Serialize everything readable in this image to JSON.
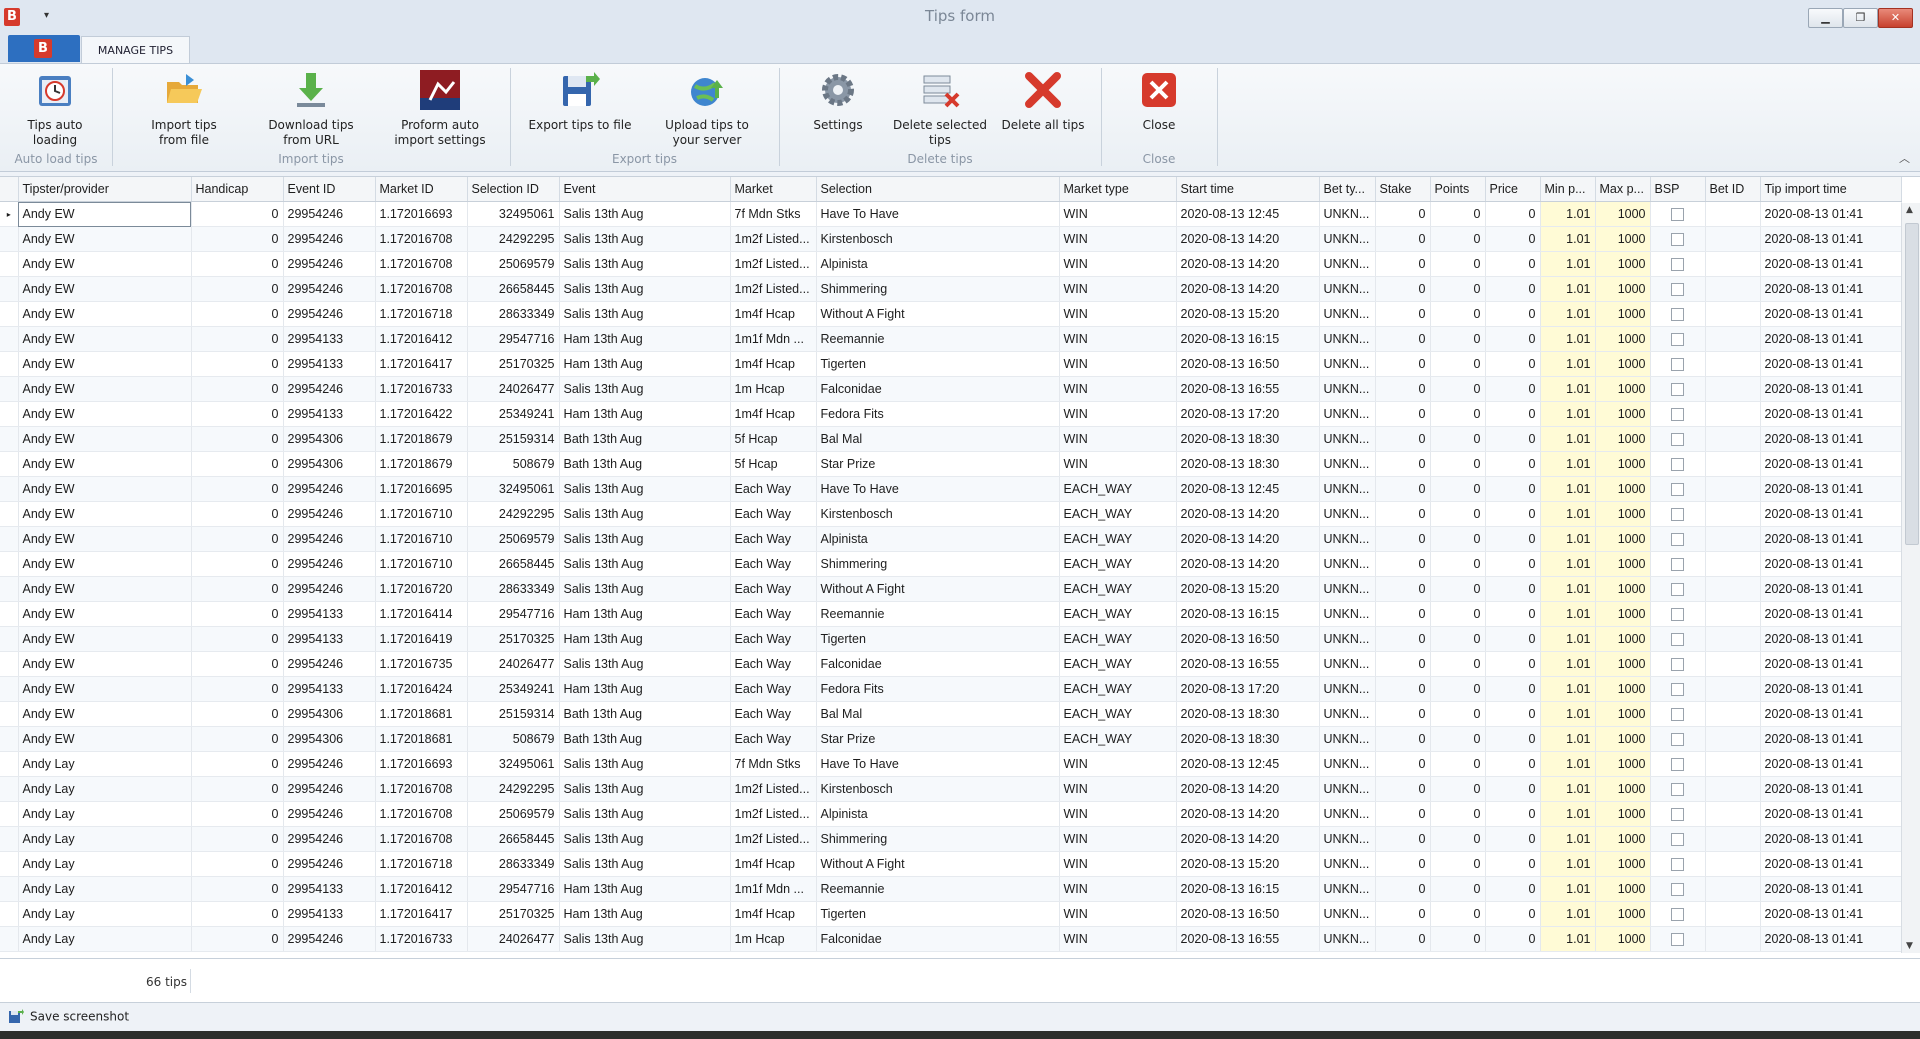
{
  "window": {
    "title": "Tips form",
    "app_logo": "B"
  },
  "tabs": {
    "active": "MANAGE TIPS"
  },
  "ribbon": {
    "buttons": [
      {
        "label": "Tips auto loading",
        "icon": "auto-load-icon"
      },
      {
        "label": "Import tips from file",
        "icon": "folder-open-icon"
      },
      {
        "label": "Download tips from URL",
        "icon": "download-icon"
      },
      {
        "label": "Proform auto import settings",
        "icon": "proform-icon"
      },
      {
        "label": "Export tips to file",
        "icon": "save-export-icon"
      },
      {
        "label": "Upload tips to your server",
        "icon": "globe-upload-icon"
      },
      {
        "label": "Settings",
        "icon": "gear-icon"
      },
      {
        "label": "Delete selected tips",
        "icon": "delete-selected-icon"
      },
      {
        "label": "Delete all tips",
        "icon": "delete-all-icon"
      },
      {
        "label": "Close",
        "icon": "close-icon"
      }
    ],
    "groups": [
      "Auto load tips",
      "Import tips",
      "Export tips",
      "Delete tips",
      "Close"
    ]
  },
  "grid": {
    "columns": [
      "Tipster/provider",
      "Handicap",
      "Event ID",
      "Market ID",
      "Selection ID",
      "Event",
      "Market",
      "Selection",
      "Market type",
      "Start time",
      "Bet ty...",
      "Stake",
      "Points",
      "Price",
      "Min p...",
      "Max p...",
      "BSP",
      "Bet ID",
      "Tip import time"
    ],
    "rows": [
      [
        "Andy EW",
        "0",
        "29954246",
        "1.172016693",
        "32495061",
        "Salis  13th Aug",
        "7f Mdn Stks",
        "Have To Have",
        "WIN",
        "2020-08-13 12:45",
        "UNKN...",
        "0",
        "0",
        "0",
        "1.01",
        "1000",
        "",
        "",
        "2020-08-13 01:41"
      ],
      [
        "Andy EW",
        "0",
        "29954246",
        "1.172016708",
        "24292295",
        "Salis  13th Aug",
        "1m2f Listed...",
        "Kirstenbosch",
        "WIN",
        "2020-08-13 14:20",
        "UNKN...",
        "0",
        "0",
        "0",
        "1.01",
        "1000",
        "",
        "",
        "2020-08-13 01:41"
      ],
      [
        "Andy EW",
        "0",
        "29954246",
        "1.172016708",
        "25069579",
        "Salis  13th Aug",
        "1m2f Listed...",
        "Alpinista",
        "WIN",
        "2020-08-13 14:20",
        "UNKN...",
        "0",
        "0",
        "0",
        "1.01",
        "1000",
        "",
        "",
        "2020-08-13 01:41"
      ],
      [
        "Andy EW",
        "0",
        "29954246",
        "1.172016708",
        "26658445",
        "Salis  13th Aug",
        "1m2f Listed...",
        "Shimmering",
        "WIN",
        "2020-08-13 14:20",
        "UNKN...",
        "0",
        "0",
        "0",
        "1.01",
        "1000",
        "",
        "",
        "2020-08-13 01:41"
      ],
      [
        "Andy EW",
        "0",
        "29954246",
        "1.172016718",
        "28633349",
        "Salis  13th Aug",
        "1m4f Hcap",
        "Without A Fight",
        "WIN",
        "2020-08-13 15:20",
        "UNKN...",
        "0",
        "0",
        "0",
        "1.01",
        "1000",
        "",
        "",
        "2020-08-13 01:41"
      ],
      [
        "Andy EW",
        "0",
        "29954133",
        "1.172016412",
        "29547716",
        "Ham  13th Aug",
        "1m1f Mdn ...",
        "Reemannie",
        "WIN",
        "2020-08-13 16:15",
        "UNKN...",
        "0",
        "0",
        "0",
        "1.01",
        "1000",
        "",
        "",
        "2020-08-13 01:41"
      ],
      [
        "Andy EW",
        "0",
        "29954133",
        "1.172016417",
        "25170325",
        "Ham  13th Aug",
        "1m4f Hcap",
        "Tigerten",
        "WIN",
        "2020-08-13 16:50",
        "UNKN...",
        "0",
        "0",
        "0",
        "1.01",
        "1000",
        "",
        "",
        "2020-08-13 01:41"
      ],
      [
        "Andy EW",
        "0",
        "29954246",
        "1.172016733",
        "24026477",
        "Salis  13th Aug",
        "1m Hcap",
        "Falconidae",
        "WIN",
        "2020-08-13 16:55",
        "UNKN...",
        "0",
        "0",
        "0",
        "1.01",
        "1000",
        "",
        "",
        "2020-08-13 01:41"
      ],
      [
        "Andy EW",
        "0",
        "29954133",
        "1.172016422",
        "25349241",
        "Ham  13th Aug",
        "1m4f Hcap",
        "Fedora Fits",
        "WIN",
        "2020-08-13 17:20",
        "UNKN...",
        "0",
        "0",
        "0",
        "1.01",
        "1000",
        "",
        "",
        "2020-08-13 01:41"
      ],
      [
        "Andy EW",
        "0",
        "29954306",
        "1.172018679",
        "25159314",
        "Bath  13th Aug",
        "5f Hcap",
        "Bal Mal",
        "WIN",
        "2020-08-13 18:30",
        "UNKN...",
        "0",
        "0",
        "0",
        "1.01",
        "1000",
        "",
        "",
        "2020-08-13 01:41"
      ],
      [
        "Andy EW",
        "0",
        "29954306",
        "1.172018679",
        "508679",
        "Bath  13th Aug",
        "5f Hcap",
        "Star Prize",
        "WIN",
        "2020-08-13 18:30",
        "UNKN...",
        "0",
        "0",
        "0",
        "1.01",
        "1000",
        "",
        "",
        "2020-08-13 01:41"
      ],
      [
        "Andy EW",
        "0",
        "29954246",
        "1.172016695",
        "32495061",
        "Salis  13th Aug",
        "Each Way",
        "Have To Have",
        "EACH_WAY",
        "2020-08-13 12:45",
        "UNKN...",
        "0",
        "0",
        "0",
        "1.01",
        "1000",
        "",
        "",
        "2020-08-13 01:41"
      ],
      [
        "Andy EW",
        "0",
        "29954246",
        "1.172016710",
        "24292295",
        "Salis  13th Aug",
        "Each Way",
        "Kirstenbosch",
        "EACH_WAY",
        "2020-08-13 14:20",
        "UNKN...",
        "0",
        "0",
        "0",
        "1.01",
        "1000",
        "",
        "",
        "2020-08-13 01:41"
      ],
      [
        "Andy EW",
        "0",
        "29954246",
        "1.172016710",
        "25069579",
        "Salis  13th Aug",
        "Each Way",
        "Alpinista",
        "EACH_WAY",
        "2020-08-13 14:20",
        "UNKN...",
        "0",
        "0",
        "0",
        "1.01",
        "1000",
        "",
        "",
        "2020-08-13 01:41"
      ],
      [
        "Andy EW",
        "0",
        "29954246",
        "1.172016710",
        "26658445",
        "Salis  13th Aug",
        "Each Way",
        "Shimmering",
        "EACH_WAY",
        "2020-08-13 14:20",
        "UNKN...",
        "0",
        "0",
        "0",
        "1.01",
        "1000",
        "",
        "",
        "2020-08-13 01:41"
      ],
      [
        "Andy EW",
        "0",
        "29954246",
        "1.172016720",
        "28633349",
        "Salis  13th Aug",
        "Each Way",
        "Without A Fight",
        "EACH_WAY",
        "2020-08-13 15:20",
        "UNKN...",
        "0",
        "0",
        "0",
        "1.01",
        "1000",
        "",
        "",
        "2020-08-13 01:41"
      ],
      [
        "Andy EW",
        "0",
        "29954133",
        "1.172016414",
        "29547716",
        "Ham  13th Aug",
        "Each Way",
        "Reemannie",
        "EACH_WAY",
        "2020-08-13 16:15",
        "UNKN...",
        "0",
        "0",
        "0",
        "1.01",
        "1000",
        "",
        "",
        "2020-08-13 01:41"
      ],
      [
        "Andy EW",
        "0",
        "29954133",
        "1.172016419",
        "25170325",
        "Ham  13th Aug",
        "Each Way",
        "Tigerten",
        "EACH_WAY",
        "2020-08-13 16:50",
        "UNKN...",
        "0",
        "0",
        "0",
        "1.01",
        "1000",
        "",
        "",
        "2020-08-13 01:41"
      ],
      [
        "Andy EW",
        "0",
        "29954246",
        "1.172016735",
        "24026477",
        "Salis  13th Aug",
        "Each Way",
        "Falconidae",
        "EACH_WAY",
        "2020-08-13 16:55",
        "UNKN...",
        "0",
        "0",
        "0",
        "1.01",
        "1000",
        "",
        "",
        "2020-08-13 01:41"
      ],
      [
        "Andy EW",
        "0",
        "29954133",
        "1.172016424",
        "25349241",
        "Ham  13th Aug",
        "Each Way",
        "Fedora Fits",
        "EACH_WAY",
        "2020-08-13 17:20",
        "UNKN...",
        "0",
        "0",
        "0",
        "1.01",
        "1000",
        "",
        "",
        "2020-08-13 01:41"
      ],
      [
        "Andy EW",
        "0",
        "29954306",
        "1.172018681",
        "25159314",
        "Bath  13th Aug",
        "Each Way",
        "Bal Mal",
        "EACH_WAY",
        "2020-08-13 18:30",
        "UNKN...",
        "0",
        "0",
        "0",
        "1.01",
        "1000",
        "",
        "",
        "2020-08-13 01:41"
      ],
      [
        "Andy EW",
        "0",
        "29954306",
        "1.172018681",
        "508679",
        "Bath  13th Aug",
        "Each Way",
        "Star Prize",
        "EACH_WAY",
        "2020-08-13 18:30",
        "UNKN...",
        "0",
        "0",
        "0",
        "1.01",
        "1000",
        "",
        "",
        "2020-08-13 01:41"
      ],
      [
        "Andy Lay",
        "0",
        "29954246",
        "1.172016693",
        "32495061",
        "Salis  13th Aug",
        "7f Mdn Stks",
        "Have To Have",
        "WIN",
        "2020-08-13 12:45",
        "UNKN...",
        "0",
        "0",
        "0",
        "1.01",
        "1000",
        "",
        "",
        "2020-08-13 01:41"
      ],
      [
        "Andy Lay",
        "0",
        "29954246",
        "1.172016708",
        "24292295",
        "Salis  13th Aug",
        "1m2f Listed...",
        "Kirstenbosch",
        "WIN",
        "2020-08-13 14:20",
        "UNKN...",
        "0",
        "0",
        "0",
        "1.01",
        "1000",
        "",
        "",
        "2020-08-13 01:41"
      ],
      [
        "Andy Lay",
        "0",
        "29954246",
        "1.172016708",
        "25069579",
        "Salis  13th Aug",
        "1m2f Listed...",
        "Alpinista",
        "WIN",
        "2020-08-13 14:20",
        "UNKN...",
        "0",
        "0",
        "0",
        "1.01",
        "1000",
        "",
        "",
        "2020-08-13 01:41"
      ],
      [
        "Andy Lay",
        "0",
        "29954246",
        "1.172016708",
        "26658445",
        "Salis  13th Aug",
        "1m2f Listed...",
        "Shimmering",
        "WIN",
        "2020-08-13 14:20",
        "UNKN...",
        "0",
        "0",
        "0",
        "1.01",
        "1000",
        "",
        "",
        "2020-08-13 01:41"
      ],
      [
        "Andy Lay",
        "0",
        "29954246",
        "1.172016718",
        "28633349",
        "Salis  13th Aug",
        "1m4f Hcap",
        "Without A Fight",
        "WIN",
        "2020-08-13 15:20",
        "UNKN...",
        "0",
        "0",
        "0",
        "1.01",
        "1000",
        "",
        "",
        "2020-08-13 01:41"
      ],
      [
        "Andy Lay",
        "0",
        "29954133",
        "1.172016412",
        "29547716",
        "Ham  13th Aug",
        "1m1f Mdn ...",
        "Reemannie",
        "WIN",
        "2020-08-13 16:15",
        "UNKN...",
        "0",
        "0",
        "0",
        "1.01",
        "1000",
        "",
        "",
        "2020-08-13 01:41"
      ],
      [
        "Andy Lay",
        "0",
        "29954133",
        "1.172016417",
        "25170325",
        "Ham  13th Aug",
        "1m4f Hcap",
        "Tigerten",
        "WIN",
        "2020-08-13 16:50",
        "UNKN...",
        "0",
        "0",
        "0",
        "1.01",
        "1000",
        "",
        "",
        "2020-08-13 01:41"
      ],
      [
        "Andy Lay",
        "0",
        "29954246",
        "1.172016733",
        "24026477",
        "Salis  13th Aug",
        "1m Hcap",
        "Falconidae",
        "WIN",
        "2020-08-13 16:55",
        "UNKN...",
        "0",
        "0",
        "0",
        "1.01",
        "1000",
        "",
        "",
        "2020-08-13 01:41"
      ]
    ],
    "footer_count": "66 tips"
  },
  "status": {
    "save_label": "Save screenshot"
  },
  "colors": {
    "accent": "#2d6fc0",
    "logo_red": "#d63a2c",
    "price_highlight": "#fffbd6"
  }
}
